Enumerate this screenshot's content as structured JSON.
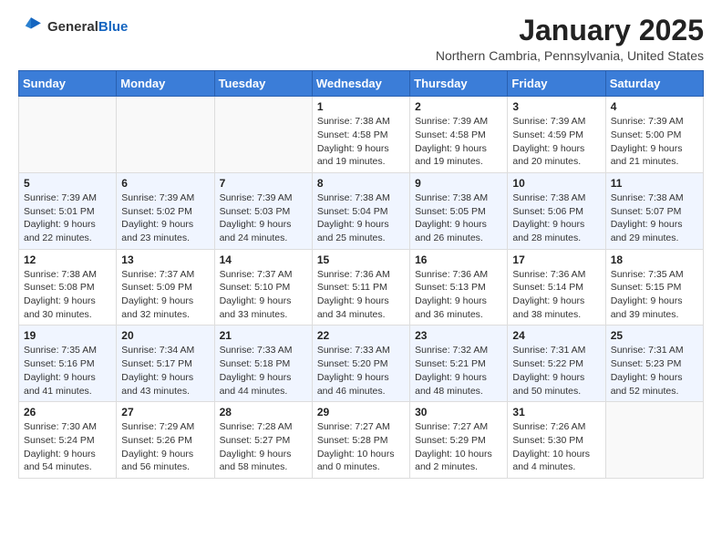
{
  "header": {
    "logo_general": "General",
    "logo_blue": "Blue",
    "month_title": "January 2025",
    "subtitle": "Northern Cambria, Pennsylvania, United States"
  },
  "days_of_week": [
    "Sunday",
    "Monday",
    "Tuesday",
    "Wednesday",
    "Thursday",
    "Friday",
    "Saturday"
  ],
  "weeks": [
    [
      {
        "day": "",
        "info": ""
      },
      {
        "day": "",
        "info": ""
      },
      {
        "day": "",
        "info": ""
      },
      {
        "day": "1",
        "info": "Sunrise: 7:38 AM\nSunset: 4:58 PM\nDaylight: 9 hours\nand 19 minutes."
      },
      {
        "day": "2",
        "info": "Sunrise: 7:39 AM\nSunset: 4:58 PM\nDaylight: 9 hours\nand 19 minutes."
      },
      {
        "day": "3",
        "info": "Sunrise: 7:39 AM\nSunset: 4:59 PM\nDaylight: 9 hours\nand 20 minutes."
      },
      {
        "day": "4",
        "info": "Sunrise: 7:39 AM\nSunset: 5:00 PM\nDaylight: 9 hours\nand 21 minutes."
      }
    ],
    [
      {
        "day": "5",
        "info": "Sunrise: 7:39 AM\nSunset: 5:01 PM\nDaylight: 9 hours\nand 22 minutes."
      },
      {
        "day": "6",
        "info": "Sunrise: 7:39 AM\nSunset: 5:02 PM\nDaylight: 9 hours\nand 23 minutes."
      },
      {
        "day": "7",
        "info": "Sunrise: 7:39 AM\nSunset: 5:03 PM\nDaylight: 9 hours\nand 24 minutes."
      },
      {
        "day": "8",
        "info": "Sunrise: 7:38 AM\nSunset: 5:04 PM\nDaylight: 9 hours\nand 25 minutes."
      },
      {
        "day": "9",
        "info": "Sunrise: 7:38 AM\nSunset: 5:05 PM\nDaylight: 9 hours\nand 26 minutes."
      },
      {
        "day": "10",
        "info": "Sunrise: 7:38 AM\nSunset: 5:06 PM\nDaylight: 9 hours\nand 28 minutes."
      },
      {
        "day": "11",
        "info": "Sunrise: 7:38 AM\nSunset: 5:07 PM\nDaylight: 9 hours\nand 29 minutes."
      }
    ],
    [
      {
        "day": "12",
        "info": "Sunrise: 7:38 AM\nSunset: 5:08 PM\nDaylight: 9 hours\nand 30 minutes."
      },
      {
        "day": "13",
        "info": "Sunrise: 7:37 AM\nSunset: 5:09 PM\nDaylight: 9 hours\nand 32 minutes."
      },
      {
        "day": "14",
        "info": "Sunrise: 7:37 AM\nSunset: 5:10 PM\nDaylight: 9 hours\nand 33 minutes."
      },
      {
        "day": "15",
        "info": "Sunrise: 7:36 AM\nSunset: 5:11 PM\nDaylight: 9 hours\nand 34 minutes."
      },
      {
        "day": "16",
        "info": "Sunrise: 7:36 AM\nSunset: 5:13 PM\nDaylight: 9 hours\nand 36 minutes."
      },
      {
        "day": "17",
        "info": "Sunrise: 7:36 AM\nSunset: 5:14 PM\nDaylight: 9 hours\nand 38 minutes."
      },
      {
        "day": "18",
        "info": "Sunrise: 7:35 AM\nSunset: 5:15 PM\nDaylight: 9 hours\nand 39 minutes."
      }
    ],
    [
      {
        "day": "19",
        "info": "Sunrise: 7:35 AM\nSunset: 5:16 PM\nDaylight: 9 hours\nand 41 minutes."
      },
      {
        "day": "20",
        "info": "Sunrise: 7:34 AM\nSunset: 5:17 PM\nDaylight: 9 hours\nand 43 minutes."
      },
      {
        "day": "21",
        "info": "Sunrise: 7:33 AM\nSunset: 5:18 PM\nDaylight: 9 hours\nand 44 minutes."
      },
      {
        "day": "22",
        "info": "Sunrise: 7:33 AM\nSunset: 5:20 PM\nDaylight: 9 hours\nand 46 minutes."
      },
      {
        "day": "23",
        "info": "Sunrise: 7:32 AM\nSunset: 5:21 PM\nDaylight: 9 hours\nand 48 minutes."
      },
      {
        "day": "24",
        "info": "Sunrise: 7:31 AM\nSunset: 5:22 PM\nDaylight: 9 hours\nand 50 minutes."
      },
      {
        "day": "25",
        "info": "Sunrise: 7:31 AM\nSunset: 5:23 PM\nDaylight: 9 hours\nand 52 minutes."
      }
    ],
    [
      {
        "day": "26",
        "info": "Sunrise: 7:30 AM\nSunset: 5:24 PM\nDaylight: 9 hours\nand 54 minutes."
      },
      {
        "day": "27",
        "info": "Sunrise: 7:29 AM\nSunset: 5:26 PM\nDaylight: 9 hours\nand 56 minutes."
      },
      {
        "day": "28",
        "info": "Sunrise: 7:28 AM\nSunset: 5:27 PM\nDaylight: 9 hours\nand 58 minutes."
      },
      {
        "day": "29",
        "info": "Sunrise: 7:27 AM\nSunset: 5:28 PM\nDaylight: 10 hours\nand 0 minutes."
      },
      {
        "day": "30",
        "info": "Sunrise: 7:27 AM\nSunset: 5:29 PM\nDaylight: 10 hours\nand 2 minutes."
      },
      {
        "day": "31",
        "info": "Sunrise: 7:26 AM\nSunset: 5:30 PM\nDaylight: 10 hours\nand 4 minutes."
      },
      {
        "day": "",
        "info": ""
      }
    ]
  ],
  "colors": {
    "header_bg": "#3b7dd8",
    "accent_blue": "#1565c0"
  }
}
